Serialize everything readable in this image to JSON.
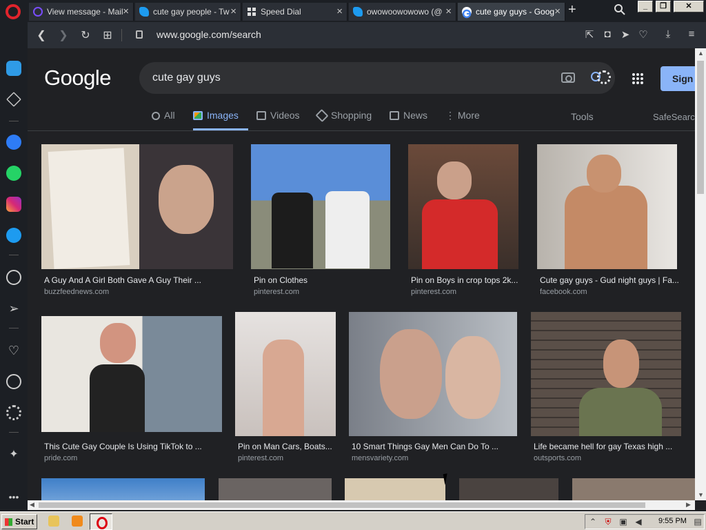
{
  "browser": {
    "tabs": [
      {
        "title": "View message - Mail",
        "icon": "mail-icon"
      },
      {
        "title": "cute gay people - Tw",
        "icon": "twitter-icon"
      },
      {
        "title": "Speed Dial",
        "icon": "speed-dial-icon"
      },
      {
        "title": "owowoowowowo (@",
        "icon": "twitter-icon"
      },
      {
        "title": "cute gay guys - Goog",
        "icon": "google-icon",
        "active": true
      }
    ],
    "url": "www.google.com/search",
    "accent_color": "#e0242c"
  },
  "google": {
    "logo": "Google",
    "query": "cute gay guys",
    "sign_in": "Sign",
    "tabs": [
      {
        "label": "All",
        "icon": "search-icon"
      },
      {
        "label": "Images",
        "icon": "image-icon",
        "active": true
      },
      {
        "label": "Videos",
        "icon": "video-icon"
      },
      {
        "label": "Shopping",
        "icon": "tag-icon"
      },
      {
        "label": "News",
        "icon": "news-icon"
      },
      {
        "label": "More",
        "icon": "kebab-icon"
      }
    ],
    "tools": "Tools",
    "safesearch": "SafeSearch",
    "results": [
      {
        "title": "A Guy And A Girl Both Gave A Guy Their ...",
        "source": "buzzfeednews.com"
      },
      {
        "title": "Pin on Clothes",
        "source": "pinterest.com"
      },
      {
        "title": "Pin on Boys in crop tops 2k...",
        "source": "pinterest.com"
      },
      {
        "title": "Cute gay guys - Gud night guys | Fa...",
        "source": "facebook.com"
      },
      {
        "title": "This Cute Gay Couple Is Using TikTok to ...",
        "source": "pride.com"
      },
      {
        "title": "Pin on Man Cars, Boats...",
        "source": "pinterest.com"
      },
      {
        "title": "10 Smart Things Gay Men Can Do To ...",
        "source": "mensvariety.com"
      },
      {
        "title": "Life became hell for gay Texas high ...",
        "source": "outsports.com"
      }
    ],
    "accent_color": "#8ab4f8"
  },
  "taskbar": {
    "start_label": "Start",
    "clock": "9:55 PM"
  }
}
